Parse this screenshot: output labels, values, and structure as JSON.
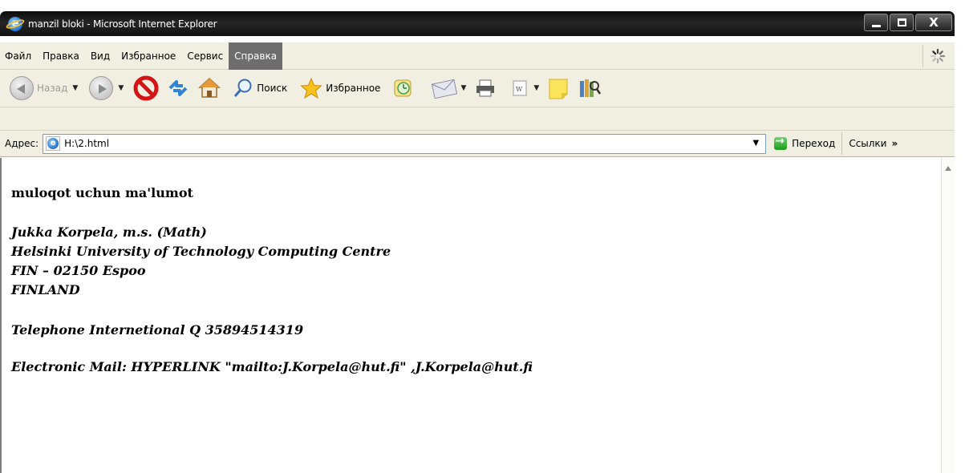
{
  "window": {
    "title": "manzil bloki - Microsoft Internet Explorer",
    "buttons": {
      "minimize": "_",
      "maximize": "□",
      "close": "X"
    }
  },
  "menu": {
    "items": [
      {
        "label": "Файл",
        "active": false
      },
      {
        "label": "Правка",
        "active": false
      },
      {
        "label": "Вид",
        "active": false
      },
      {
        "label": "Избранное",
        "active": false
      },
      {
        "label": "Сервис",
        "active": false
      },
      {
        "label": "Справка",
        "active": true
      }
    ]
  },
  "toolbar": {
    "back_label": "Назад",
    "search_label": "Поиск",
    "favorites_label": "Избранное"
  },
  "address": {
    "label": "Адрес:",
    "value": "H:\\2.html",
    "go_label": "Переход",
    "links_label": "Ссылки",
    "chevron": "»"
  },
  "page": {
    "heading": "muloqot uchun ma'lumot",
    "address_lines": [
      "Jukka Korpela, m.s. (Math)",
      "Helsinki University of Technology Computing Centre",
      "FIN – 02150 Espoo",
      "FINLAND"
    ],
    "phone": "Telephone Internetional Q 35894514319",
    "email": "Electronic Mail: HYPERLINK \"mailto:J.Korpela@hut.fi\" ,J.Korpela@hut.fi"
  },
  "colors": {
    "titlebar": "#1a1a1a",
    "chrome": "#f1efe2",
    "active_menu": "#6d6d6d",
    "address_border": "#7f9db9"
  }
}
